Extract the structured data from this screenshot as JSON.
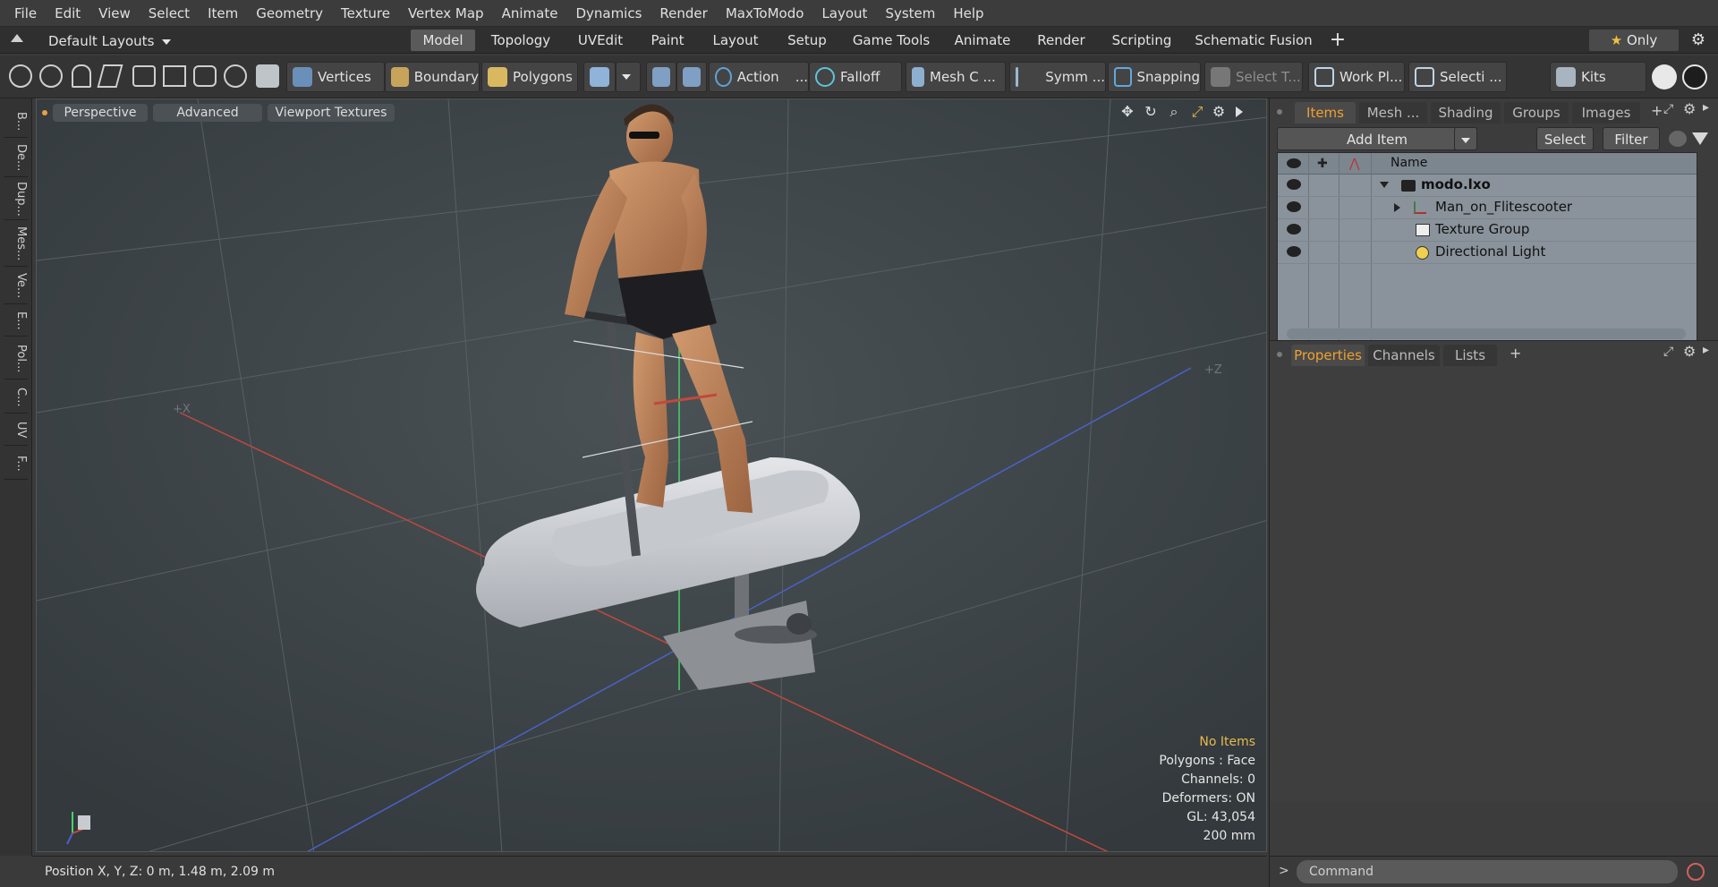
{
  "menu": [
    "File",
    "Edit",
    "View",
    "Select",
    "Item",
    "Geometry",
    "Texture",
    "Vertex Map",
    "Animate",
    "Dynamics",
    "Render",
    "MaxToModo",
    "Layout",
    "System",
    "Help"
  ],
  "layoutbar": {
    "preset": "Default Layouts",
    "tabs": [
      "Model",
      "Topology",
      "UVEdit",
      "Paint",
      "Layout",
      "Setup",
      "Game Tools",
      "Animate",
      "Render",
      "Scripting",
      "Schematic Fusion"
    ],
    "active_tab": "Model",
    "add_label": "+",
    "only_label": "Only"
  },
  "toolbar": {
    "vertices": "Vertices",
    "boundary": "Boundary",
    "polygons": "Polygons",
    "action": "Action",
    "action_more": "...",
    "falloff": "Falloff",
    "mesh": "Mesh C ...",
    "symm": "Symm ...",
    "snapping": "Snapping",
    "select_t": "Select T...",
    "work_plane": "Work Pl...",
    "selecti": "Selecti ...",
    "kits": "Kits"
  },
  "left_tabs": [
    "B...",
    "De...",
    "Dup...",
    "Mes...",
    "Ve...",
    "E...",
    "Pol...",
    "C...",
    "UV",
    "F..."
  ],
  "viewport": {
    "perspective": "Perspective",
    "advanced": "Advanced",
    "textures": "Viewport Textures",
    "axis_label": "+Z",
    "axis_label2": "+X",
    "info": {
      "items": "No Items",
      "polygons": "Polygons : Face",
      "channels": "Channels: 0",
      "deformers": "Deformers: ON",
      "gl": "GL: 43,054",
      "scale": "200 mm"
    }
  },
  "status": {
    "position": "Position X, Y, Z:   0 m, 1.48 m, 2.09 m"
  },
  "items_panel": {
    "tabs": [
      "Items",
      "Mesh ...",
      "Shading",
      "Groups",
      "Images"
    ],
    "active_tab": "Items",
    "add_item": "Add Item",
    "select": "Select",
    "filter": "Filter",
    "column_name": "Name",
    "rows": [
      {
        "name": "modo.lxo",
        "bold": true
      },
      {
        "name": "Man_on_Flitescooter"
      },
      {
        "name": "Texture Group"
      },
      {
        "name": "Directional Light"
      }
    ]
  },
  "properties_panel": {
    "tabs": [
      "Properties",
      "Channels",
      "Lists"
    ],
    "active_tab": "Properties",
    "add": "+"
  },
  "command": {
    "placeholder": "Command",
    "prompt": ">"
  },
  "colors": {
    "accent": "#f0a030",
    "viewport_bg": "#3f4549",
    "list_bg": "#8a939b"
  }
}
